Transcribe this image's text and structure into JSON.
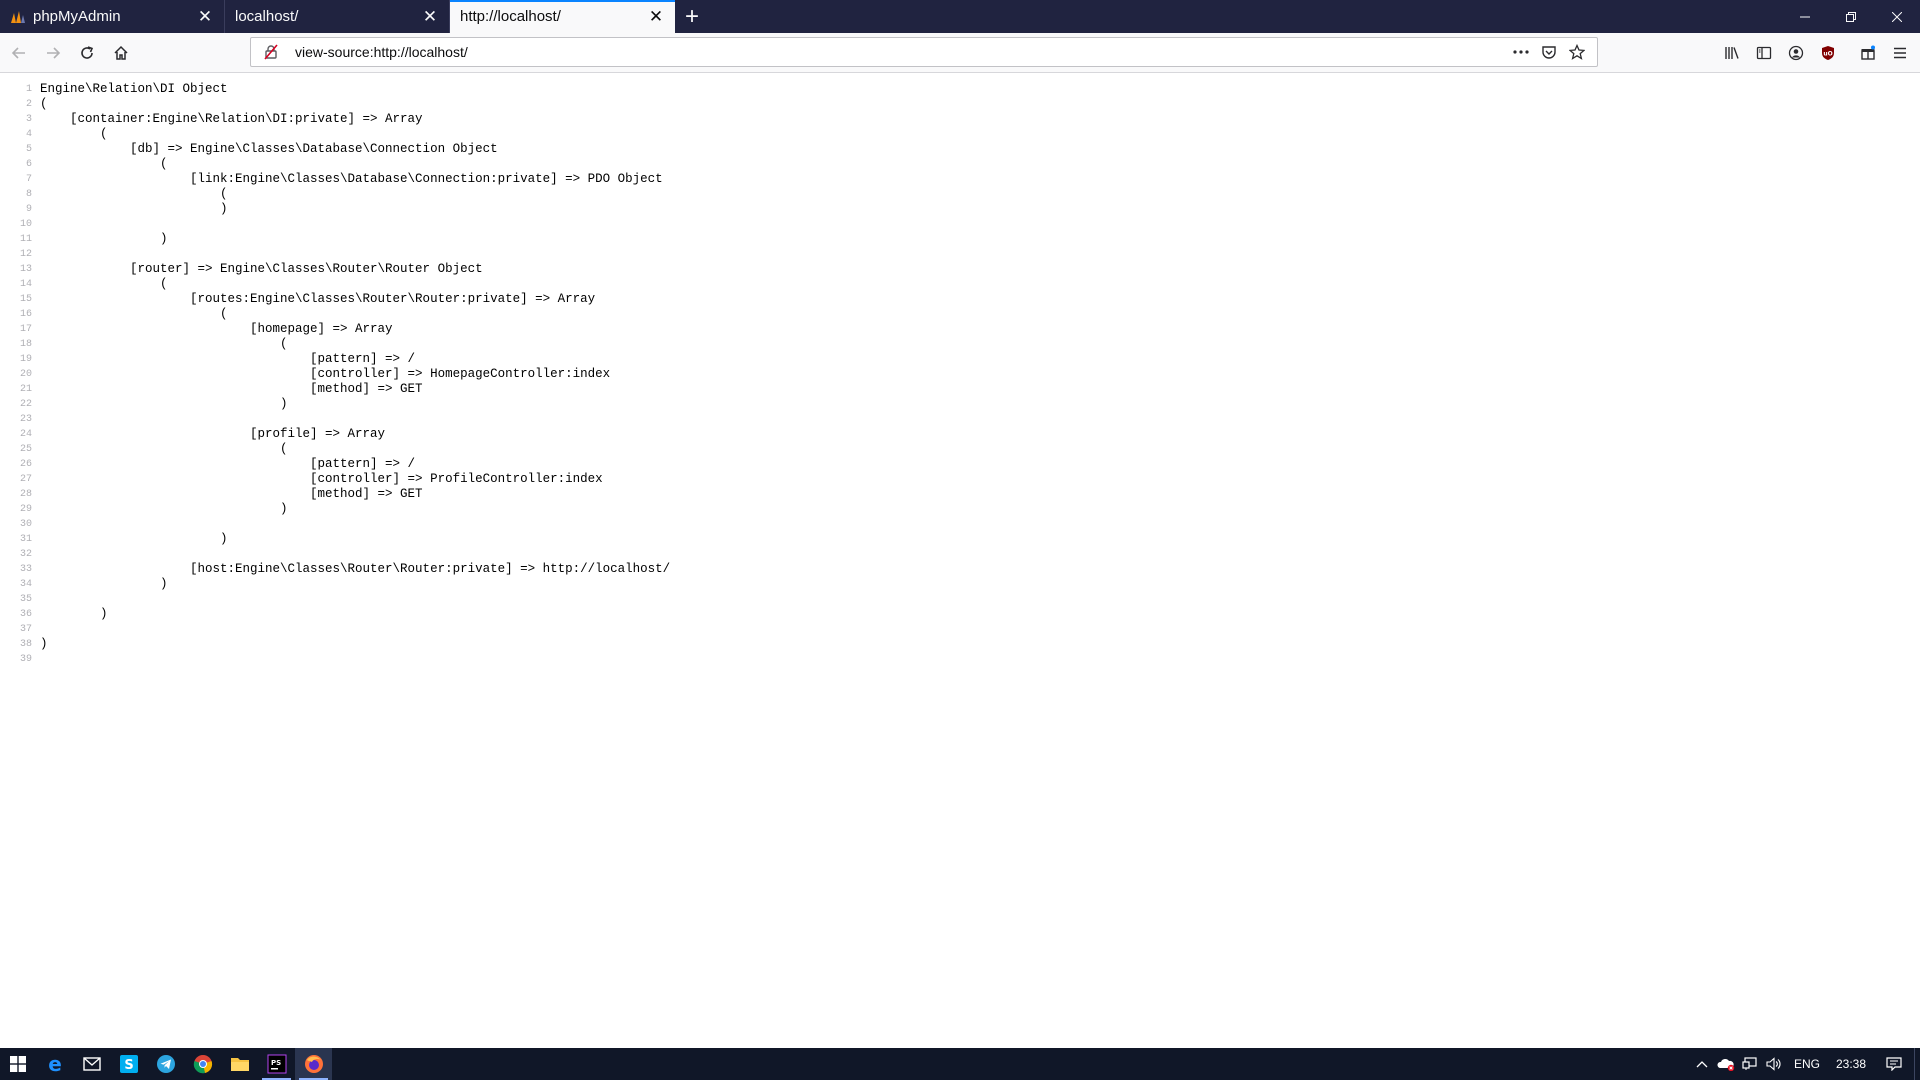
{
  "browser": {
    "tabs": [
      {
        "title": "phpMyAdmin",
        "favicon": "phpmyadmin-icon",
        "active": false
      },
      {
        "title": "localhost/",
        "favicon": "",
        "active": false
      },
      {
        "title": "http://localhost/",
        "favicon": "",
        "active": true
      }
    ],
    "url": "view-source:http://localhost/",
    "colors": {
      "tabstrip": "#202340",
      "accent": "#0a84ff",
      "toolbar": "#f9f9fa"
    }
  },
  "source": {
    "lines": [
      {
        "n": "1",
        "text": "Engine\\Relation\\DI Object"
      },
      {
        "n": "2",
        "text": "("
      },
      {
        "n": "3",
        "text": "    [container:Engine\\Relation\\DI:private] => Array"
      },
      {
        "n": "4",
        "text": "        ("
      },
      {
        "n": "5",
        "text": "            [db] => Engine\\Classes\\Database\\Connection Object"
      },
      {
        "n": "6",
        "text": "                ("
      },
      {
        "n": "7",
        "text": "                    [link:Engine\\Classes\\Database\\Connection:private] => PDO Object"
      },
      {
        "n": "8",
        "text": "                        ("
      },
      {
        "n": "9",
        "text": "                        )"
      },
      {
        "n": "10",
        "text": ""
      },
      {
        "n": "11",
        "text": "                )"
      },
      {
        "n": "12",
        "text": ""
      },
      {
        "n": "13",
        "text": "            [router] => Engine\\Classes\\Router\\Router Object"
      },
      {
        "n": "14",
        "text": "                ("
      },
      {
        "n": "15",
        "text": "                    [routes:Engine\\Classes\\Router\\Router:private] => Array"
      },
      {
        "n": "16",
        "text": "                        ("
      },
      {
        "n": "17",
        "text": "                            [homepage] => Array"
      },
      {
        "n": "18",
        "text": "                                ("
      },
      {
        "n": "19",
        "text": "                                    [pattern] => /"
      },
      {
        "n": "20",
        "text": "                                    [controller] => HomepageController:index"
      },
      {
        "n": "21",
        "text": "                                    [method] => GET"
      },
      {
        "n": "22",
        "text": "                                )"
      },
      {
        "n": "23",
        "text": ""
      },
      {
        "n": "24",
        "text": "                            [profile] => Array"
      },
      {
        "n": "25",
        "text": "                                ("
      },
      {
        "n": "26",
        "text": "                                    [pattern] => /"
      },
      {
        "n": "27",
        "text": "                                    [controller] => ProfileController:index"
      },
      {
        "n": "28",
        "text": "                                    [method] => GET"
      },
      {
        "n": "29",
        "text": "                                )"
      },
      {
        "n": "30",
        "text": ""
      },
      {
        "n": "31",
        "text": "                        )"
      },
      {
        "n": "32",
        "text": ""
      },
      {
        "n": "33",
        "text": "                    [host:Engine\\Classes\\Router\\Router:private] => http://localhost/"
      },
      {
        "n": "34",
        "text": "                )"
      },
      {
        "n": "35",
        "text": ""
      },
      {
        "n": "36",
        "text": "        )"
      },
      {
        "n": "37",
        "text": ""
      },
      {
        "n": "38",
        "text": ")"
      },
      {
        "n": "39",
        "text": ""
      }
    ]
  },
  "taskbar": {
    "apps": [
      "windows-start-icon",
      "edge-icon",
      "mail-icon",
      "skype-icon",
      "telegram-icon",
      "chrome-icon",
      "file-explorer-icon",
      "phpstorm-icon",
      "firefox-icon"
    ],
    "language": "ENG",
    "time": "23:38"
  }
}
